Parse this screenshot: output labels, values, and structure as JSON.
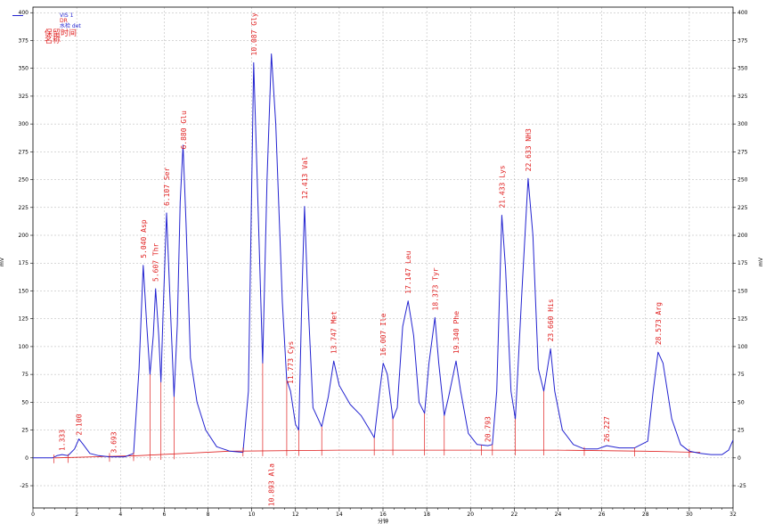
{
  "chart_data": {
    "type": "line",
    "xlabel": "分钟",
    "ylabel": "mV",
    "ylabel_right": "mV",
    "xlim": [
      0,
      32
    ],
    "ylim": [
      -45,
      405
    ],
    "x_ticks": [
      0,
      2,
      4,
      6,
      8,
      10,
      12,
      14,
      16,
      18,
      20,
      22,
      24,
      26,
      28,
      30,
      32
    ],
    "y_ticks": [
      -25,
      0,
      25,
      50,
      75,
      100,
      125,
      150,
      175,
      200,
      225,
      250,
      275,
      300,
      325,
      350,
      375,
      400
    ],
    "grid": true,
    "legend": {
      "placement": "top-left",
      "entries": [
        {
          "name": "VIS 1",
          "color": "#2323d0"
        },
        {
          "name": "DR",
          "color": "#e02020"
        },
        {
          "name": "水检 det",
          "color": "#2323d0"
        }
      ],
      "annotations": [
        "保留时间",
        "名称"
      ]
    },
    "series": [
      {
        "name": "VIS 1",
        "color": "#2323d0",
        "points": [
          [
            0,
            0
          ],
          [
            0.9,
            0
          ],
          [
            1.1,
            2
          ],
          [
            1.333,
            3
          ],
          [
            1.6,
            2
          ],
          [
            1.9,
            8
          ],
          [
            2.1,
            17
          ],
          [
            2.3,
            12
          ],
          [
            2.6,
            4
          ],
          [
            3.0,
            2
          ],
          [
            3.5,
            1
          ],
          [
            4.2,
            1
          ],
          [
            4.6,
            4
          ],
          [
            4.85,
            80
          ],
          [
            5.04,
            173
          ],
          [
            5.2,
            120
          ],
          [
            5.35,
            75
          ],
          [
            5.5,
            110
          ],
          [
            5.607,
            152
          ],
          [
            5.75,
            110
          ],
          [
            5.85,
            68
          ],
          [
            5.95,
            130
          ],
          [
            6.107,
            220
          ],
          [
            6.25,
            150
          ],
          [
            6.45,
            55
          ],
          [
            6.6,
            120
          ],
          [
            6.73,
            230
          ],
          [
            6.86,
            281
          ],
          [
            7.0,
            210
          ],
          [
            7.2,
            90
          ],
          [
            7.5,
            50
          ],
          [
            7.9,
            25
          ],
          [
            8.4,
            10
          ],
          [
            9.0,
            6
          ],
          [
            9.6,
            5
          ],
          [
            9.85,
            60
          ],
          [
            10.087,
            355
          ],
          [
            10.25,
            250
          ],
          [
            10.5,
            85
          ],
          [
            10.7,
            250
          ],
          [
            10.9,
            363
          ],
          [
            11.1,
            300
          ],
          [
            11.4,
            140
          ],
          [
            11.6,
            70
          ],
          [
            11.773,
            60
          ],
          [
            12.0,
            30
          ],
          [
            12.15,
            25
          ],
          [
            12.3,
            150
          ],
          [
            12.413,
            226
          ],
          [
            12.55,
            150
          ],
          [
            12.8,
            45
          ],
          [
            13.2,
            28
          ],
          [
            13.5,
            55
          ],
          [
            13.747,
            87
          ],
          [
            14.0,
            65
          ],
          [
            14.5,
            48
          ],
          [
            15.0,
            38
          ],
          [
            15.4,
            25
          ],
          [
            15.6,
            18
          ],
          [
            15.85,
            60
          ],
          [
            16.007,
            85
          ],
          [
            16.2,
            75
          ],
          [
            16.45,
            35
          ],
          [
            16.65,
            45
          ],
          [
            16.9,
            118
          ],
          [
            17.147,
            141
          ],
          [
            17.4,
            110
          ],
          [
            17.65,
            50
          ],
          [
            17.9,
            40
          ],
          [
            18.1,
            85
          ],
          [
            18.373,
            126
          ],
          [
            18.55,
            85
          ],
          [
            18.8,
            38
          ],
          [
            19.0,
            55
          ],
          [
            19.34,
            87
          ],
          [
            19.55,
            60
          ],
          [
            19.9,
            22
          ],
          [
            20.3,
            12
          ],
          [
            20.793,
            11
          ],
          [
            21.0,
            12
          ],
          [
            21.2,
            60
          ],
          [
            21.433,
            218
          ],
          [
            21.6,
            170
          ],
          [
            21.85,
            60
          ],
          [
            22.05,
            35
          ],
          [
            22.35,
            150
          ],
          [
            22.633,
            251
          ],
          [
            22.85,
            200
          ],
          [
            23.1,
            80
          ],
          [
            23.35,
            60
          ],
          [
            23.66,
            98
          ],
          [
            23.85,
            60
          ],
          [
            24.2,
            25
          ],
          [
            24.7,
            12
          ],
          [
            25.2,
            8
          ],
          [
            25.8,
            8
          ],
          [
            26.227,
            11
          ],
          [
            26.8,
            9
          ],
          [
            27.5,
            9
          ],
          [
            28.1,
            15
          ],
          [
            28.35,
            60
          ],
          [
            28.573,
            95
          ],
          [
            28.8,
            85
          ],
          [
            29.2,
            35
          ],
          [
            29.6,
            12
          ],
          [
            30.0,
            6
          ],
          [
            30.5,
            4
          ],
          [
            31.0,
            3
          ],
          [
            31.5,
            3
          ],
          [
            31.8,
            7
          ],
          [
            32.0,
            16
          ]
        ]
      }
    ],
    "baseline": {
      "color": "#e02020",
      "points": [
        [
          1.0,
          0
        ],
        [
          4.8,
          2
        ],
        [
          9.0,
          6
        ],
        [
          14.0,
          7
        ],
        [
          20.0,
          7
        ],
        [
          24.0,
          7
        ],
        [
          28.0,
          6
        ],
        [
          30.5,
          5
        ]
      ]
    },
    "peaks": [
      {
        "time": "1.333",
        "x": 1.333,
        "label": "1.333",
        "name": ""
      },
      {
        "time": "2.100",
        "x": 2.1,
        "label": "2.100",
        "name": ""
      },
      {
        "time": "3.693",
        "x": 3.693,
        "label": "3.693",
        "name": ""
      },
      {
        "time": "5.040",
        "x": 5.04,
        "label": "5.040 Asp",
        "name": "Asp"
      },
      {
        "time": "5.607",
        "x": 5.607,
        "label": "5.607 Thr",
        "name": "Thr"
      },
      {
        "time": "6.107",
        "x": 6.107,
        "label": "6.107 Ser",
        "name": "Ser"
      },
      {
        "time": "6.880",
        "x": 6.88,
        "label": "6.880 Glu",
        "name": "Glu"
      },
      {
        "time": "10.087",
        "x": 10.087,
        "label": "10.087 Gly",
        "name": "Gly"
      },
      {
        "time": "10.893",
        "x": 10.893,
        "label": "10.893 Ala",
        "name": "Ala"
      },
      {
        "time": "11.773",
        "x": 11.773,
        "label": "11.773 Cys",
        "name": "Cys"
      },
      {
        "time": "12.413",
        "x": 12.413,
        "label": "12.413 Val",
        "name": "Val"
      },
      {
        "time": "13.747",
        "x": 13.747,
        "label": "13.747 Met",
        "name": "Met"
      },
      {
        "time": "16.007",
        "x": 16.007,
        "label": "16.007 Ile",
        "name": "Ile"
      },
      {
        "time": "17.147",
        "x": 17.147,
        "label": "17.147 Leu",
        "name": "Leu"
      },
      {
        "time": "18.373",
        "x": 18.373,
        "label": "18.373 Tyr",
        "name": "Tyr"
      },
      {
        "time": "19.340",
        "x": 19.34,
        "label": "19.340 Phe",
        "name": "Phe"
      },
      {
        "time": "20.793",
        "x": 20.793,
        "label": "20.793",
        "name": ""
      },
      {
        "time": "21.433",
        "x": 21.433,
        "label": "21.433 Lys",
        "name": "Lys"
      },
      {
        "time": "22.633",
        "x": 22.633,
        "label": "22.633 NH3",
        "name": "NH3"
      },
      {
        "time": "23.660",
        "x": 23.66,
        "label": "23.660 His",
        "name": "His"
      },
      {
        "time": "26.227",
        "x": 26.227,
        "label": "26.227",
        "name": ""
      },
      {
        "time": "28.573",
        "x": 28.573,
        "label": "28.573 Arg",
        "name": "Arg"
      }
    ]
  }
}
